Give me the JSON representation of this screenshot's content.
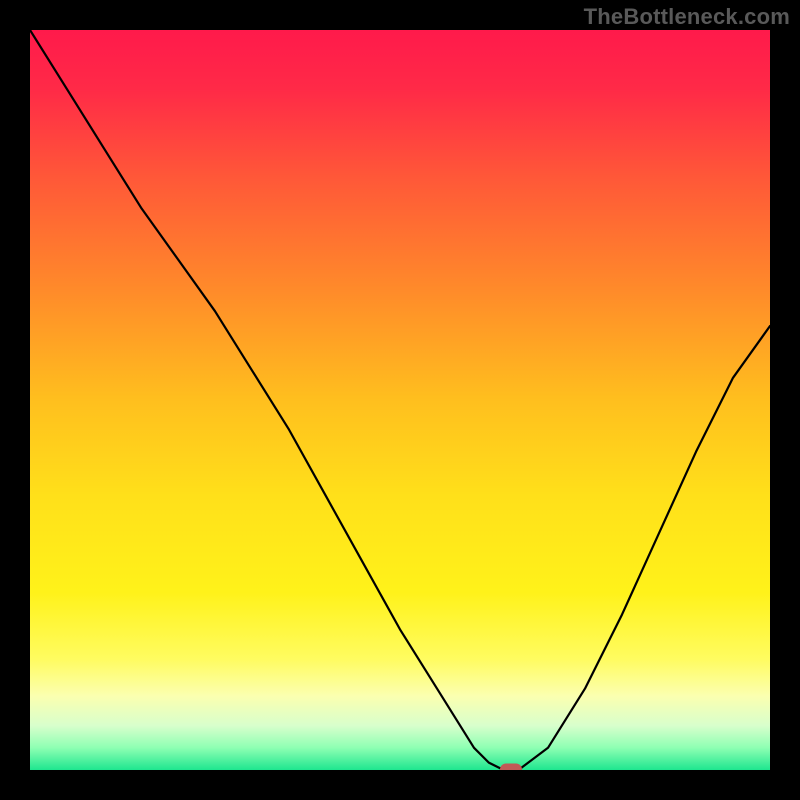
{
  "watermark": "TheBottleneck.com",
  "colors": {
    "gradient_stops": [
      {
        "offset": 0.0,
        "color": "#ff1a4b"
      },
      {
        "offset": 0.08,
        "color": "#ff2a47"
      },
      {
        "offset": 0.2,
        "color": "#ff5838"
      },
      {
        "offset": 0.35,
        "color": "#ff8a2a"
      },
      {
        "offset": 0.5,
        "color": "#ffbf1e"
      },
      {
        "offset": 0.63,
        "color": "#ffe01a"
      },
      {
        "offset": 0.76,
        "color": "#fff21a"
      },
      {
        "offset": 0.85,
        "color": "#fffc60"
      },
      {
        "offset": 0.9,
        "color": "#fbffb0"
      },
      {
        "offset": 0.94,
        "color": "#d8ffcc"
      },
      {
        "offset": 0.97,
        "color": "#8effb3"
      },
      {
        "offset": 1.0,
        "color": "#1fe68f"
      }
    ],
    "curve": "#000000",
    "marker": "#c05a56",
    "frame": "#000000"
  },
  "chart_data": {
    "type": "line",
    "title": "",
    "xlabel": "",
    "ylabel": "",
    "xlim": [
      0,
      100
    ],
    "ylim": [
      0,
      100
    ],
    "grid": false,
    "series": [
      {
        "name": "bottleneck-curve",
        "x": [
          0,
          5,
          10,
          15,
          20,
          25,
          30,
          35,
          40,
          45,
          50,
          55,
          60,
          62,
          64,
          65,
          66,
          70,
          75,
          80,
          85,
          90,
          95,
          100
        ],
        "y": [
          100,
          92,
          84,
          76,
          69,
          62,
          54,
          46,
          37,
          28,
          19,
          11,
          3,
          1,
          0,
          0,
          0,
          3,
          11,
          21,
          32,
          43,
          53,
          60
        ]
      }
    ],
    "annotations": [
      {
        "type": "marker",
        "name": "optimal-point",
        "x": 65,
        "y": 0
      }
    ]
  }
}
